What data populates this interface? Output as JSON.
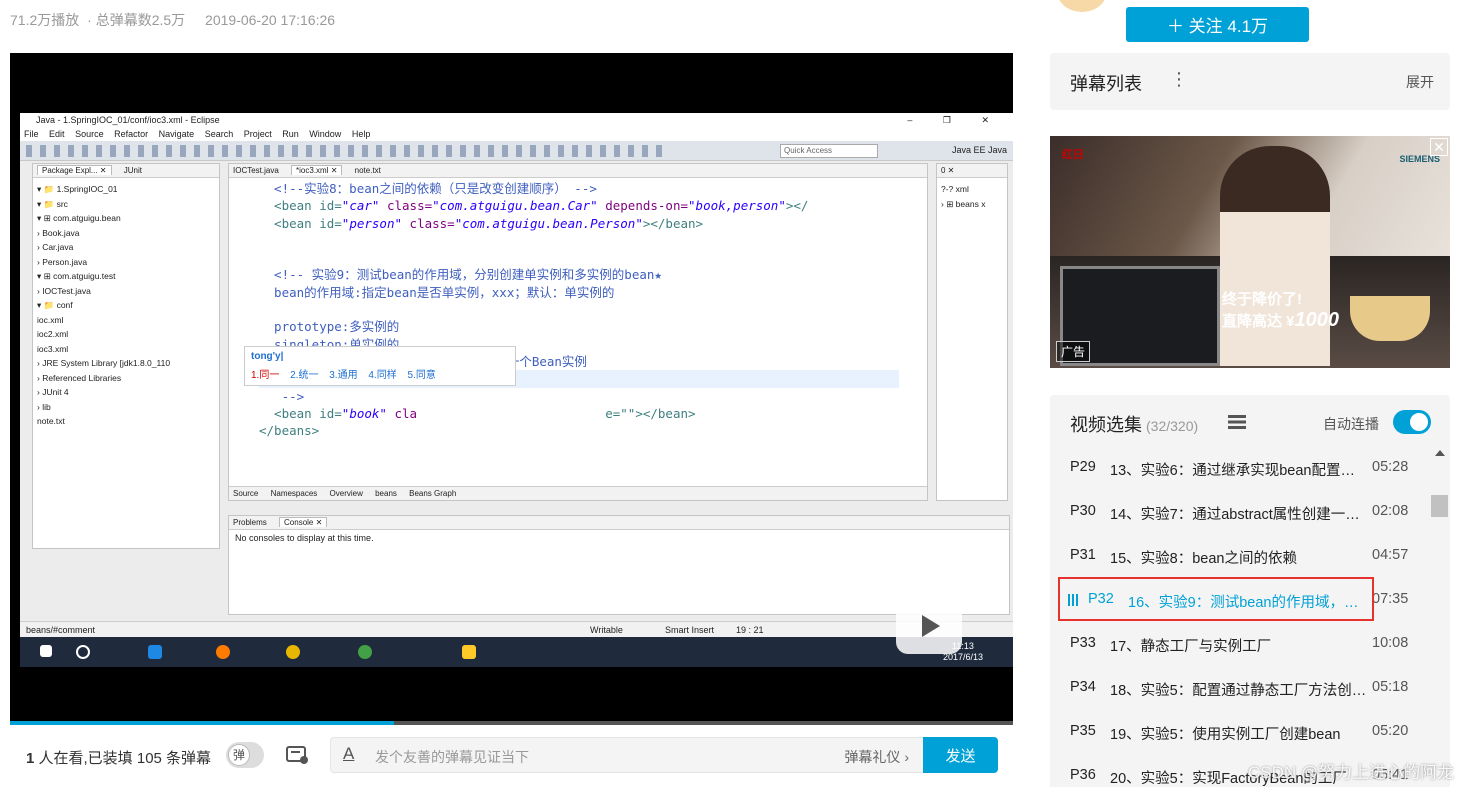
{
  "stats": {
    "plays": "71.2万播放",
    "danmaku_total": "· 总弹幕数2.5万",
    "date": "2019-06-20 17:16:26"
  },
  "follow": {
    "label": "＋  关注 4.1万"
  },
  "danmaku_list": {
    "title": "弹幕列表",
    "menu": "⋮",
    "expand": "展开"
  },
  "ad": {
    "brand_left": "红日",
    "brand_right": "SIEMENS",
    "slogan1": "终于降价了!",
    "slogan2_prefix": "直降高达 ¥",
    "slogan2_amount": "1000",
    "tag": "广告",
    "close": "✕"
  },
  "episodes": {
    "title": "视频选集",
    "count": "(32/320)",
    "autoplay_label": "自动连播",
    "autoplay_on": true,
    "items": [
      {
        "pno": "P29",
        "title": "13、实验6：通过继承实现bean配置信息的重用",
        "duration": "05:28"
      },
      {
        "pno": "P30",
        "title": "14、实验7：通过abstract属性创建一个模板bean",
        "duration": "02:08"
      },
      {
        "pno": "P31",
        "title": "15、实验8：bean之间的依赖",
        "duration": "04:57"
      },
      {
        "pno": "P32",
        "title": "16、实验9：测试bean的作用域，分别创建单实例和多实例的bean",
        "duration": "07:35",
        "active": true
      },
      {
        "pno": "P33",
        "title": "17、静态工厂与实例工厂",
        "duration": "10:08"
      },
      {
        "pno": "P34",
        "title": "18、实验5：配置通过静态工厂方法创建的bean",
        "duration": "05:18"
      },
      {
        "pno": "P35",
        "title": "19、实验5：使用实例工厂创建bean",
        "duration": "05:20"
      },
      {
        "pno": "P36",
        "title": "20、实验5：实现FactoryBean的工厂",
        "duration": "05:41"
      }
    ]
  },
  "watermark": "CSDN @努力上进心的阿龙",
  "player": {
    "progress_fraction": 0.383,
    "viewers_count": "1",
    "viewers_text": " 人在看,已装填 105 条弹幕",
    "dm_toggle": "弹",
    "input_placeholder": "发个友善的弹幕见证当下",
    "etiquette": "弹幕礼仪 ›",
    "send": "发送"
  },
  "eclipse": {
    "title": "Java - 1.SpringIOC_01/conf/ioc3.xml - Eclipse",
    "window_buttons": "–  ❐  ✕",
    "menu": [
      "File",
      "Edit",
      "Source",
      "Refactor",
      "Navigate",
      "Search",
      "Project",
      "Run",
      "Window",
      "Help"
    ],
    "quick_access": "Quick Access",
    "perspectives": "Java EE   Java",
    "explorer_tabs": [
      "Package Expl... ✕",
      "JUnit"
    ],
    "tree": [
      "▾ 📁 1.SpringIOC_01",
      "   ▾ 📁 src",
      "      ▾ ⊞ com.atguigu.bean",
      "         › Book.java",
      "         › Car.java",
      "         › Person.java",
      "      ▾ ⊞ com.atguigu.test",
      "         › IOCTest.java",
      "   ▾ 📁 conf",
      "         ioc.xml",
      "         ioc2.xml",
      "         ioc3.xml",
      "   › JRE System Library [jdk1.8.0_110",
      "   › Referenced Libraries",
      "   › JUnit 4",
      "   › lib",
      "      note.txt"
    ],
    "editor_tabs": [
      "IOCTest.java",
      "*ioc3.xml ✕",
      "note.txt"
    ],
    "code": {
      "l1": "  <!--实验8：bean之间的依赖（只是改变创建顺序） -->",
      "l2a": "  <bean id=",
      "l2b": "\"car\"",
      "l2c": " class=",
      "l2d": "\"com.atguigu.bean.Car\"",
      "l2e": " depends-on=",
      "l2f": "\"book,person\"",
      "l2g": "></",
      "l3a": "  <bean id=",
      "l3b": "\"person\"",
      "l3c": " class=",
      "l3d": "\"com.atguigu.bean.Person\"",
      "l3e": "></bean>",
      "l4": "  <!-- 实验9：测试bean的作用域，分别创建单实例和多实例的bean★",
      "l5": "  bean的作用域:指定bean是否单实例，xxx；默认：单实例的",
      "l6": "  prototype:多实例的",
      "l7": "  singleton:单实例的",
      "l8": "  request:在web环境下，同一次请求创建一个Bean实例",
      "l9": "  session:在web环境下，",
      "l10": "   -->",
      "l11a": "  <bean id=",
      "l11b": "\"book\"",
      "l11c": " cla",
      "l11d": "e=\"\"></bean>",
      "l12": "</beans>"
    },
    "ime_pinyin": "tong'y|",
    "ime_candidates": [
      "1.同一",
      "2.统一",
      "3.通用",
      "4.同样",
      "5.同意"
    ],
    "bottom_tabs": [
      "Source",
      "Namespaces",
      "Overview",
      "beans",
      "Beans Graph"
    ],
    "console_tabs": [
      "Problems",
      "Console ✕"
    ],
    "console_text": "No consoles to display at this time.",
    "outline_items": [
      "?-? xml",
      "› ⊞ beans x"
    ],
    "status": {
      "path": "beans/#comment",
      "writable": "Writable",
      "insert": "Smart Insert",
      "pos": "19 : 21"
    },
    "clock_time": "11:13",
    "clock_date": "2017/6/13"
  }
}
